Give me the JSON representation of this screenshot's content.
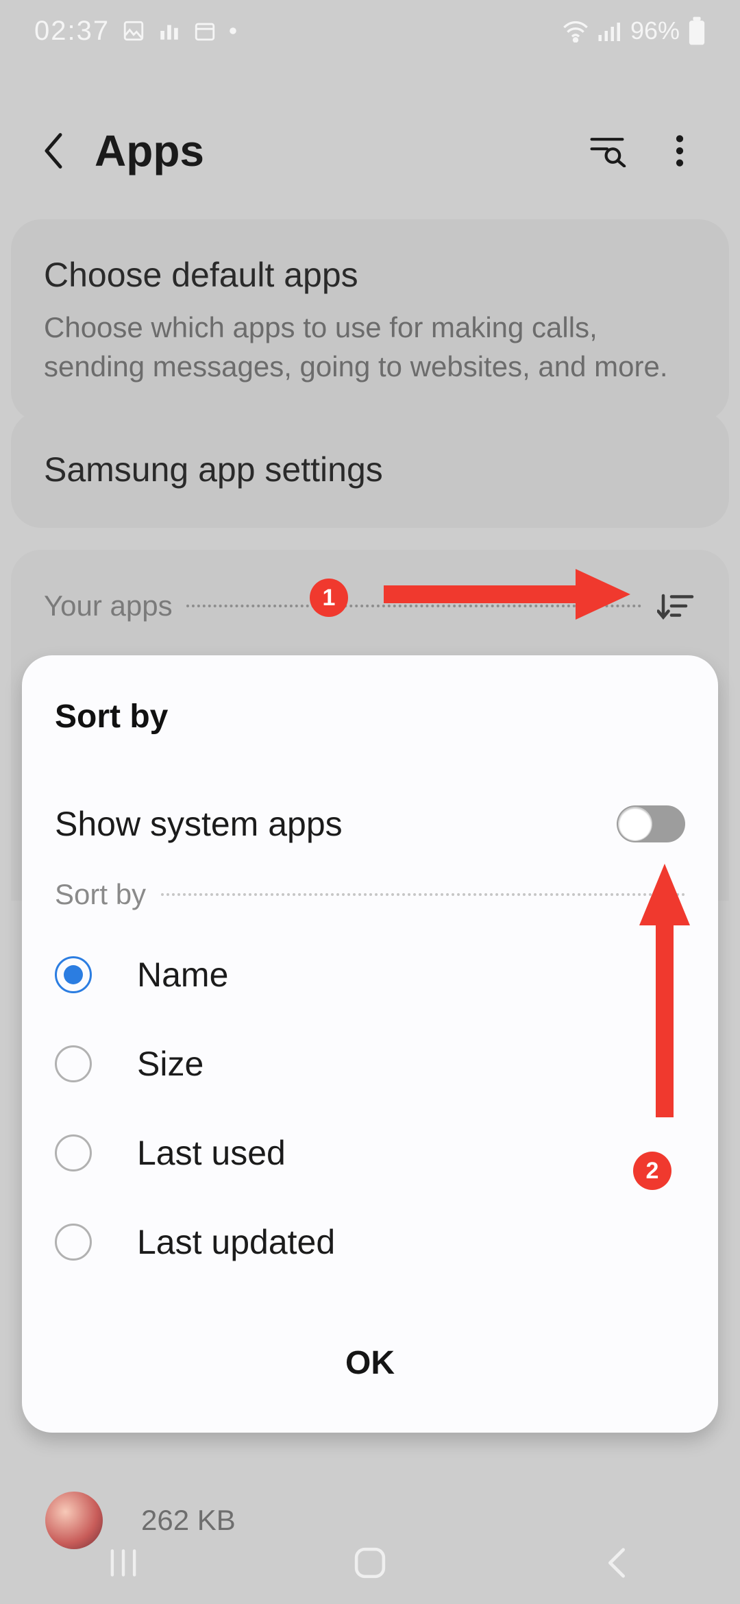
{
  "status": {
    "time": "02:37",
    "battery_percent": "96%"
  },
  "header": {
    "title": "Apps"
  },
  "cards": {
    "defaults": {
      "title": "Choose default apps",
      "subtitle": "Choose which apps to use for making calls, sending messages, going to websites, and more."
    },
    "samsung": {
      "title": "Samsung app settings"
    },
    "your_apps_label": "Your apps"
  },
  "sheet": {
    "title": "Sort by",
    "show_system_label": "Show system apps",
    "show_system_on": false,
    "sort_label": "Sort by",
    "options": {
      "name": "Name",
      "size": "Size",
      "last_used": "Last used",
      "last_updated": "Last updated"
    },
    "selected": "name",
    "ok_label": "OK"
  },
  "peek": {
    "size": "262 KB"
  },
  "annotations": {
    "badge1": "1",
    "badge2": "2"
  },
  "colors": {
    "accent_red": "#f0392e",
    "accent_blue": "#2b7de1"
  }
}
